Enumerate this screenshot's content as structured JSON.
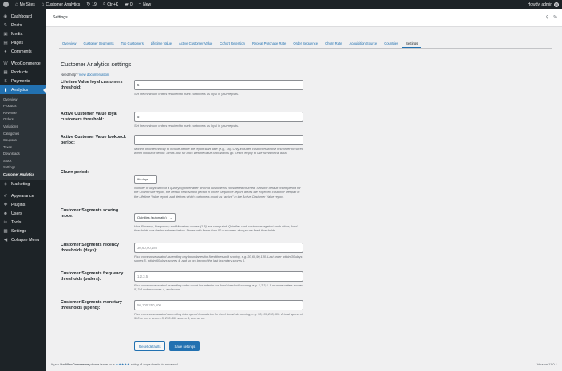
{
  "admin_bar": {
    "my_sites": "My Sites",
    "site_name": "Customer Analytics",
    "updates_count": "19",
    "search_shortcut": "Ctrl+K",
    "comments_count": "0",
    "new_label": "New",
    "howdy": "Howdy, admin"
  },
  "sidebar": {
    "items": [
      {
        "label": "Dashboard",
        "icon": "dashboard-icon",
        "glyph": "◉"
      },
      {
        "label": "Posts",
        "icon": "pin-icon",
        "glyph": "✎"
      },
      {
        "label": "Media",
        "icon": "media-icon",
        "glyph": "▣"
      },
      {
        "label": "Pages",
        "icon": "pages-icon",
        "glyph": "▤"
      },
      {
        "label": "Comments",
        "icon": "comments-icon",
        "glyph": "●"
      },
      {
        "label": "WooCommerce",
        "icon": "woocommerce-icon",
        "glyph": "W"
      },
      {
        "label": "Products",
        "icon": "products-icon",
        "glyph": "▦"
      },
      {
        "label": "Payments",
        "icon": "payments-icon",
        "glyph": "$"
      },
      {
        "label": "Analytics",
        "icon": "analytics-icon",
        "glyph": "▮"
      }
    ],
    "submenu": [
      "Overview",
      "Products",
      "Revenue",
      "Orders",
      "Variations",
      "Categories",
      "Coupons",
      "Taxes",
      "Downloads",
      "Stock",
      "Settings",
      "Customer Analytics"
    ],
    "items_after": [
      {
        "label": "Marketing",
        "icon": "marketing-icon",
        "glyph": "◈"
      },
      {
        "label": "Appearance",
        "icon": "appearance-icon",
        "glyph": "✐"
      },
      {
        "label": "Plugins",
        "icon": "plugins-icon",
        "glyph": "✚"
      },
      {
        "label": "Users",
        "icon": "users-icon",
        "glyph": "☻"
      },
      {
        "label": "Tools",
        "icon": "tools-icon",
        "glyph": "✂"
      },
      {
        "label": "Settings",
        "icon": "settings-icon",
        "glyph": "▩"
      },
      {
        "label": "Collapse Menu",
        "icon": "collapse-icon",
        "glyph": "◀"
      }
    ]
  },
  "header": {
    "title": "Settings"
  },
  "tabs": [
    "Overview",
    "Customer Segments",
    "Top Customers",
    "Lifetime Value",
    "Active Customer Value",
    "Cohort Retention",
    "Repeat Purchase Rate",
    "Order Sequence",
    "Churn Rate",
    "Acquisition Source",
    "Countries",
    "Settings"
  ],
  "main": {
    "title": "Customer Analytics settings",
    "help_prefix": "Need help?",
    "help_link": "View documentation",
    "help_suffix": ".",
    "fields": [
      {
        "label": "Lifetime Value loyal customers threshold:",
        "value": "5",
        "placeholder": "",
        "description": "Set the minimum orders required to mark customers as loyal in your reports."
      },
      {
        "label": "Active Customer Value loyal customers threshold:",
        "value": "5",
        "placeholder": "",
        "description": "Set the minimum orders required to mark customers as loyal in your reports."
      },
      {
        "label": "Active Customer Value lookback period:",
        "value": "",
        "placeholder": "",
        "description": "Months of order history to include before the report start date (e.g., 36). Only includes customers whose first order occurred within lookback period. Limits how far back lifetime value calculations go. Leave empty to use all historical data."
      },
      {
        "label": "Churn period:",
        "select": "90 days",
        "description": "Number of days without a qualifying order after which a customer is considered churned. Sets the default churn period for the Churn Rate report, the default reactivation period in Order Sequence report, drives the expected customer lifespan in the Lifetime Value report, and defines which customers count as \"active\" in the Active Customer Value report."
      },
      {
        "label": "Customer Segments scoring mode:",
        "select": "Quintiles (automatic)",
        "description": "How Recency, Frequency and Monetary scores (1-5) are computed. Quintiles rank customers against each other; fixed thresholds use the boundaries below. Stores with fewer than 50 customers always use fixed thresholds."
      },
      {
        "label": "Customer Segments recency thresholds (days):",
        "value": "",
        "placeholder": "30,60,90,180",
        "description": "Four comma-separated ascending day boundaries for fixed threshold scoring, e.g. 30,60,90,180. Last order within 30 days scores 5, within 60 days scores 4, and so on; beyond the last boundary scores 1."
      },
      {
        "label": "Customer Segments frequency thresholds (orders):",
        "value": "",
        "placeholder": "1,2,3,5",
        "description": "Four comma-separated ascending order count boundaries for fixed threshold scoring, e.g. 1,2,3,5. 5 or more orders scores 5, 3-4 orders scores 4, and so on."
      },
      {
        "label": "Customer Segments monetary thresholds (spend):",
        "value": "",
        "placeholder": "50,100,250,500",
        "description": "Four comma-separated ascending total spend boundaries for fixed threshold scoring, e.g. 50,100,250,500. A total spend of 500 or more scores 5, 250-499 scores 4, and so on."
      }
    ],
    "reset_label": "Reset defaults",
    "save_label": "Save settings"
  },
  "footer": {
    "prefix": "If you like ",
    "brand": "WooCommerce",
    "middle": " please leave us a ",
    "stars": "★★★★★",
    "suffix": " rating. A huge thanks in advance!",
    "version": "Version 11.0.1"
  }
}
